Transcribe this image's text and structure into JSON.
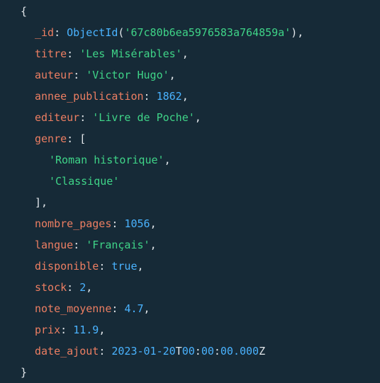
{
  "document": {
    "open_brace": "{",
    "close_brace": "}",
    "fields": {
      "id": {
        "key": "_id",
        "func": "ObjectId",
        "value": "'67c80b6ea5976583a764859a'"
      },
      "titre": {
        "key": "titre",
        "value": "'Les Misérables'"
      },
      "auteur": {
        "key": "auteur",
        "value": "'Victor Hugo'"
      },
      "annee_publication": {
        "key": "annee_publication",
        "value": "1862"
      },
      "editeur": {
        "key": "editeur",
        "value": "'Livre de Poche'"
      },
      "genre": {
        "key": "genre",
        "open": "[",
        "close": "],",
        "items": [
          "'Roman historique'",
          "'Classique'"
        ]
      },
      "nombre_pages": {
        "key": "nombre_pages",
        "value": "1056"
      },
      "langue": {
        "key": "langue",
        "value": "'Français'"
      },
      "disponible": {
        "key": "disponible",
        "value": "true"
      },
      "stock": {
        "key": "stock",
        "value": "2"
      },
      "note_moyenne": {
        "key": "note_moyenne",
        "value": "4.7"
      },
      "prix": {
        "key": "prix",
        "value": "11.9"
      },
      "date_ajout": {
        "key": "date_ajout",
        "date": "2023-01-20",
        "time_t": "T",
        "hh": "00",
        "sep1": ":",
        "mm": "00",
        "sep2": ":",
        "ss": "00.000",
        "tz": "Z"
      }
    }
  },
  "colors": {
    "background": "#162a37",
    "key": "#ec7e62",
    "string": "#3fd488",
    "number": "#4ab3ff",
    "punctuation": "#e1e6ea"
  }
}
